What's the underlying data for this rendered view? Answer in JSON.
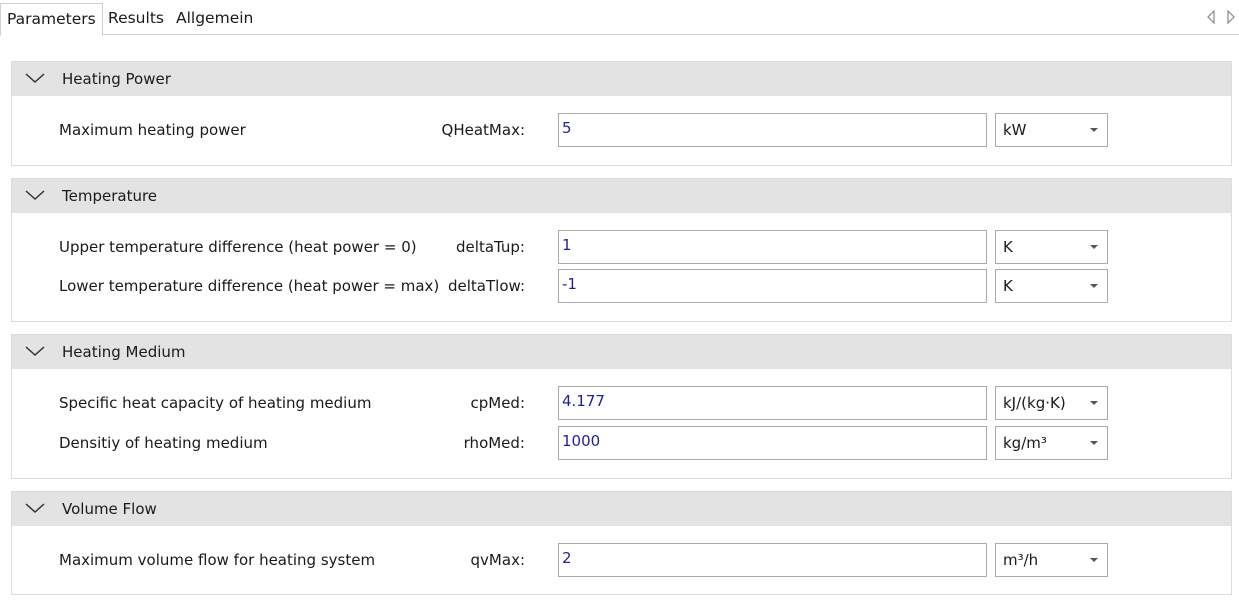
{
  "tabs": [
    {
      "label": "Parameters",
      "active": true
    },
    {
      "label": "Results",
      "active": false
    },
    {
      "label": "Allgemein",
      "active": false
    }
  ],
  "sections": [
    {
      "title": "Heating Power",
      "rows": [
        {
          "description": "Maximum heating power",
          "symbol": "QHeatMax:",
          "value": "5",
          "unit": "kW"
        }
      ]
    },
    {
      "title": "Temperature",
      "rows": [
        {
          "description": "Upper temperature difference (heat power = 0)",
          "symbol": "deltaTup:",
          "value": "1",
          "unit": "K"
        },
        {
          "description": "Lower temperature difference (heat power = max)",
          "symbol": "deltaTlow:",
          "value": "-1",
          "unit": "K"
        }
      ]
    },
    {
      "title": "Heating Medium",
      "rows": [
        {
          "description": "Specific heat capacity of heating medium",
          "symbol": "cpMed:",
          "value": "4.177",
          "unit": "kJ/(kg·K)"
        },
        {
          "description": "Densitiy of heating medium",
          "symbol": "rhoMed:",
          "value": "1000",
          "unit": "kg/m³"
        }
      ]
    },
    {
      "title": "Volume Flow",
      "rows": [
        {
          "description": "Maximum volume flow for heating system",
          "symbol": "qvMax:",
          "value": "2",
          "unit": "m³/h"
        }
      ]
    }
  ],
  "colors": {
    "value_text": "#1f1f9e",
    "header_bg": "#e3e3e3"
  },
  "icons": {
    "section_toggle": "chevron-down-icon",
    "unit_dropdown": "dropdown-arrow-icon",
    "tab_prev": "tab-scroll-left-icon",
    "tab_next": "tab-scroll-right-icon"
  }
}
